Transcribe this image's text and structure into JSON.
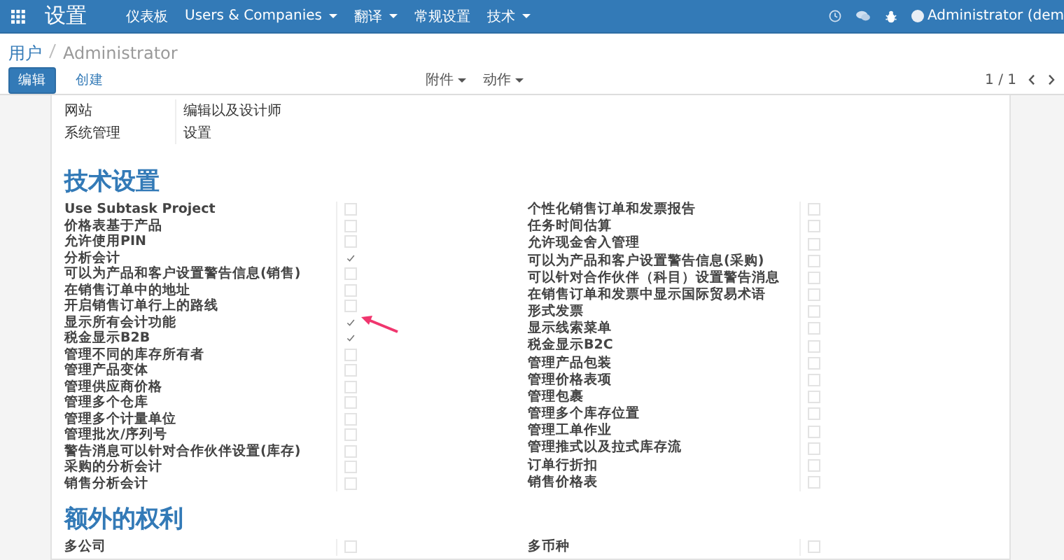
{
  "navbar": {
    "app_title": "设置",
    "menu": [
      {
        "label": "仪表板",
        "dropdown": false
      },
      {
        "label": "Users & Companies",
        "dropdown": true
      },
      {
        "label": "翻译",
        "dropdown": true
      },
      {
        "label": "常规设置",
        "dropdown": false
      },
      {
        "label": "技术",
        "dropdown": true
      }
    ],
    "user": "Administrator (dem"
  },
  "breadcrumb": {
    "parent": "用户",
    "current": "Administrator"
  },
  "buttons": {
    "edit": "编辑",
    "create": "创建"
  },
  "dropdowns": [
    "附件",
    "动作"
  ],
  "pager": "1 / 1",
  "access_rows": [
    {
      "label": "网站",
      "value": "编辑以及设计师"
    },
    {
      "label": "系统管理",
      "value": "设置"
    }
  ],
  "sections": [
    {
      "title": "技术设置",
      "left": [
        {
          "label": "Use Subtask Project",
          "checked": false
        },
        {
          "label": "价格表基于产品",
          "checked": false
        },
        {
          "label": "允许使用PIN",
          "checked": false
        },
        {
          "label": "分析会计",
          "checked": true
        },
        {
          "label": "可以为产品和客户设置警告信息(销售)",
          "checked": false
        },
        {
          "label": "在销售订单中的地址",
          "checked": false
        },
        {
          "label": "开启销售订单行上的路线",
          "checked": false
        },
        {
          "label": "显示所有会计功能",
          "checked": true,
          "annotated": true
        },
        {
          "label": "税金显示B2B",
          "checked": true
        },
        {
          "label": "管理不同的库存所有者",
          "checked": false
        },
        {
          "label": "管理产品变体",
          "checked": false
        },
        {
          "label": "管理供应商价格",
          "checked": false
        },
        {
          "label": "管理多个仓库",
          "checked": false
        },
        {
          "label": "管理多个计量单位",
          "checked": false
        },
        {
          "label": "管理批次/序列号",
          "checked": false
        },
        {
          "label": "警告消息可以针对合作伙伴设置(库存)",
          "checked": false
        },
        {
          "label": "采购的分析会计",
          "checked": false
        },
        {
          "label": "销售分析会计",
          "checked": false
        }
      ],
      "right": [
        {
          "label": "个性化销售订单和发票报告",
          "checked": false
        },
        {
          "label": "任务时间估算",
          "checked": false
        },
        {
          "label": "允许现金舍入管理",
          "checked": false
        },
        {
          "label": "可以为产品和客户设置警告信息(采购)",
          "checked": false
        },
        {
          "label": "可以针对合作伙伴（科目）设置警告消息",
          "checked": false
        },
        {
          "label": "在销售订单和发票中显示国际贸易术语",
          "checked": false
        },
        {
          "label": "形式发票",
          "checked": false
        },
        {
          "label": "显示线索菜单",
          "checked": false
        },
        {
          "label": "税金显示B2C",
          "checked": false
        },
        {
          "label": "管理产品包装",
          "checked": false
        },
        {
          "label": "管理价格表项",
          "checked": false
        },
        {
          "label": "管理包裹",
          "checked": false
        },
        {
          "label": "管理多个库存位置",
          "checked": false
        },
        {
          "label": "管理工单作业",
          "checked": false
        },
        {
          "label": "管理推式以及拉式库存流",
          "checked": false
        },
        {
          "label": "订单行折扣",
          "checked": false
        },
        {
          "label": "销售价格表",
          "checked": false
        }
      ]
    },
    {
      "title": "额外的权利",
      "left": [
        {
          "label": "多公司",
          "checked": false
        }
      ],
      "right": [
        {
          "label": "多币种",
          "checked": false
        }
      ]
    }
  ]
}
